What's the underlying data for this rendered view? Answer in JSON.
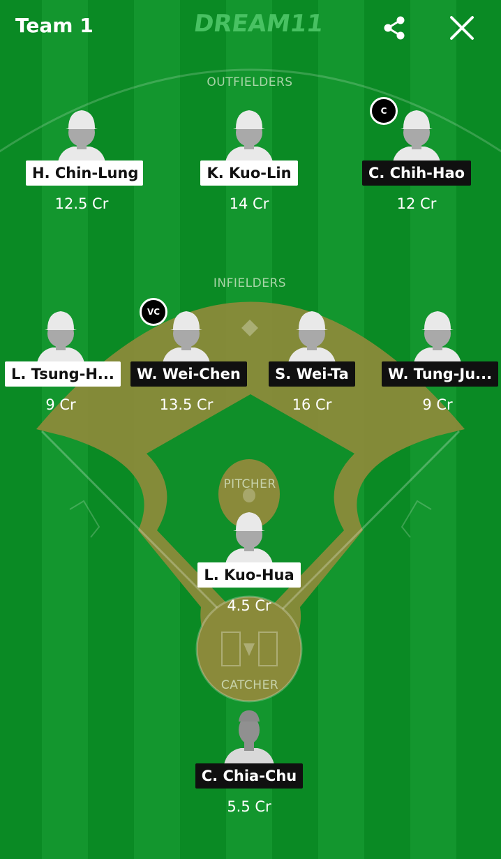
{
  "header": {
    "team_name": "Team 1",
    "brand": "DREAM11",
    "share_icon": "share-icon",
    "close_icon": "close-icon"
  },
  "sections": {
    "outfielders": "OUTFIELDERS",
    "infielders": "INFIELDERS",
    "pitcher": "PITCHER",
    "catcher": "CATCHER"
  },
  "badges": {
    "captain": "C",
    "vice_captain": "VC"
  },
  "players": {
    "h_chin_lung": {
      "name": "H. Chin-Lung",
      "credits": "12.5 Cr"
    },
    "k_kuo_lin": {
      "name": "K. Kuo-Lin",
      "credits": "14 Cr"
    },
    "c_chih_hao": {
      "name": "C. Chih-Hao",
      "credits": "12 Cr"
    },
    "l_tsung_h": {
      "name": "L. Tsung-H...",
      "credits": "9 Cr"
    },
    "w_wei_chen": {
      "name": "W. Wei-Chen",
      "credits": "13.5 Cr"
    },
    "s_wei_ta": {
      "name": "S. Wei-Ta",
      "credits": "16 Cr"
    },
    "w_tung_ju": {
      "name": "W. Tung-Ju...",
      "credits": "9 Cr"
    },
    "l_kuo_hua": {
      "name": "L. Kuo-Hua",
      "credits": "4.5 Cr"
    },
    "c_chia_chu": {
      "name": "C. Chia-Chu",
      "credits": "5.5 Cr"
    }
  },
  "colors": {
    "field_green": "#0a8a24",
    "stripe_green": "#13962e",
    "infield_dirt": "#8a8a3a",
    "brand_green": "#4fc769"
  }
}
